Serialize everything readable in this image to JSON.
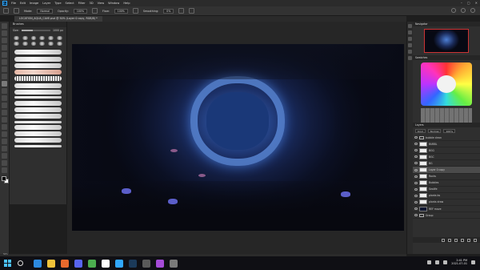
{
  "app": {
    "name": "Ps",
    "menu": [
      "File",
      "Edit",
      "Image",
      "Layer",
      "Type",
      "Select",
      "Filter",
      "3D",
      "View",
      "Window",
      "Help"
    ]
  },
  "options_bar": {
    "mode_label": "Mode:",
    "mode_value": "Normal",
    "opacity_label": "Opacity:",
    "opacity_value": "100%",
    "flow_label": "Flow:",
    "flow_value": "100%",
    "smoothing_label": "Smoothing:",
    "smoothing_value": "0%"
  },
  "document": {
    "tab_title": "LOCATION_AQUA_CAVE.psd @ 50% (Layer 0 copy, RGB/8) *"
  },
  "brushes_panel": {
    "title": "Brushes",
    "size_label": "Size:",
    "size_value": "1000 px"
  },
  "panels": {
    "navigator": "Navigator",
    "swatches": "Swatches",
    "layers": "Layers"
  },
  "layers_panel": {
    "kind": "Kind",
    "blend": "Normal",
    "opacity": "100%",
    "items": [
      {
        "name": "bubble clean",
        "thumb": "folder",
        "selected": false
      },
      {
        "name": "BUBBL",
        "thumb": "light",
        "selected": false
      },
      {
        "name": "BGG",
        "thumb": "light",
        "selected": false
      },
      {
        "name": "BGC",
        "thumb": "light",
        "selected": false
      },
      {
        "name": "BG",
        "thumb": "light",
        "selected": false
      },
      {
        "name": "Layer 0 copy",
        "thumb": "light",
        "selected": true
      },
      {
        "name": "Rocks",
        "thumb": "light",
        "selected": false
      },
      {
        "name": "Bubbles",
        "thumb": "light",
        "selected": false
      },
      {
        "name": "Sealife",
        "thumb": "light",
        "selected": false
      },
      {
        "name": "plants bs",
        "thumb": "light",
        "selected": false
      },
      {
        "name": "plants draw",
        "thumb": "light",
        "selected": false
      },
      {
        "name": "REF move",
        "thumb": "dark",
        "selected": false
      },
      {
        "name": "Group",
        "thumb": "folder",
        "selected": false
      }
    ]
  },
  "status_bar": {
    "zoom": "50%"
  },
  "taskbar": {
    "time": "2:41 PM",
    "date": "2021-07-01",
    "apps": [
      {
        "name": "edge",
        "color": "#2d8ae0"
      },
      {
        "name": "file-explorer",
        "color": "#f0c23a"
      },
      {
        "name": "firefox",
        "color": "#e8692d"
      },
      {
        "name": "discord",
        "color": "#5865f2"
      },
      {
        "name": "chrome",
        "color": "#4cae4f"
      },
      {
        "name": "notes",
        "color": "#ffffff"
      },
      {
        "name": "photoshop",
        "color": "#31a8ff"
      },
      {
        "name": "steam",
        "color": "#1b3a5a"
      },
      {
        "name": "app",
        "color": "#5a5a5a"
      },
      {
        "name": "app",
        "color": "#a54bd8"
      },
      {
        "name": "app",
        "color": "#7a7a7a"
      }
    ]
  }
}
